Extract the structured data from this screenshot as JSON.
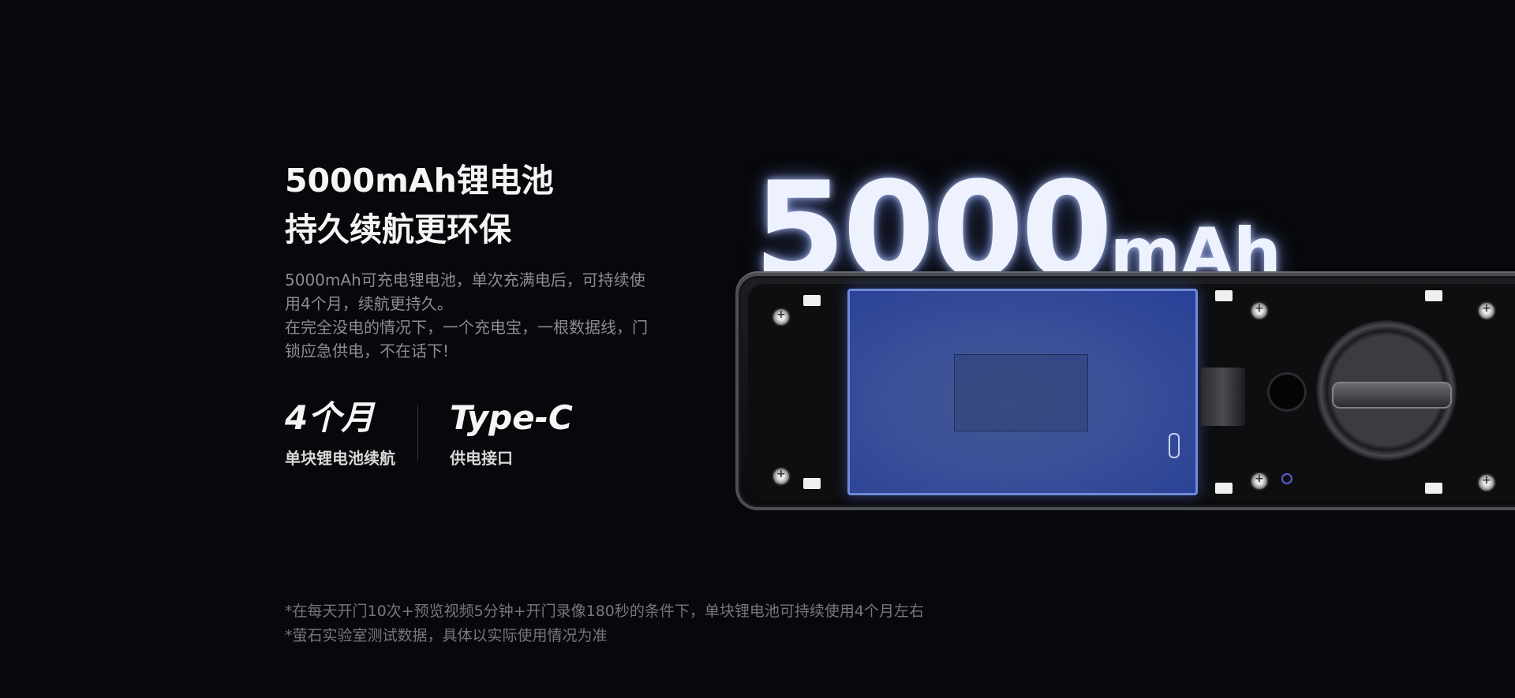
{
  "heading": {
    "line1": "5000mAh锂电池",
    "line2": "持久续航更环保"
  },
  "description": {
    "line1": "5000mAh可充电锂电池，单次充满电后，可持续使",
    "line2": "用4个月，续航更持久。",
    "line3": "在完全没电的情况下，一个充电宝，一根数据线，门",
    "line4": "锁应急供电，不在话下!"
  },
  "stats": [
    {
      "value": "4个月",
      "label": "单块锂电池续航"
    },
    {
      "value": "Type-C",
      "label": "供电接口"
    }
  ],
  "capacity": {
    "number": "5000",
    "unit": "mAh"
  },
  "footnotes": [
    "*在每天开门10次+预览视频5分钟+开门录像180秒的条件下，单块锂电池可持续使用4个月左右",
    "*萤石实验室测试数据，具体以实际使用情况为准"
  ],
  "colors": {
    "background": "#07080b",
    "battery_blue": "#3b509a",
    "glow": "#eef2ff"
  }
}
